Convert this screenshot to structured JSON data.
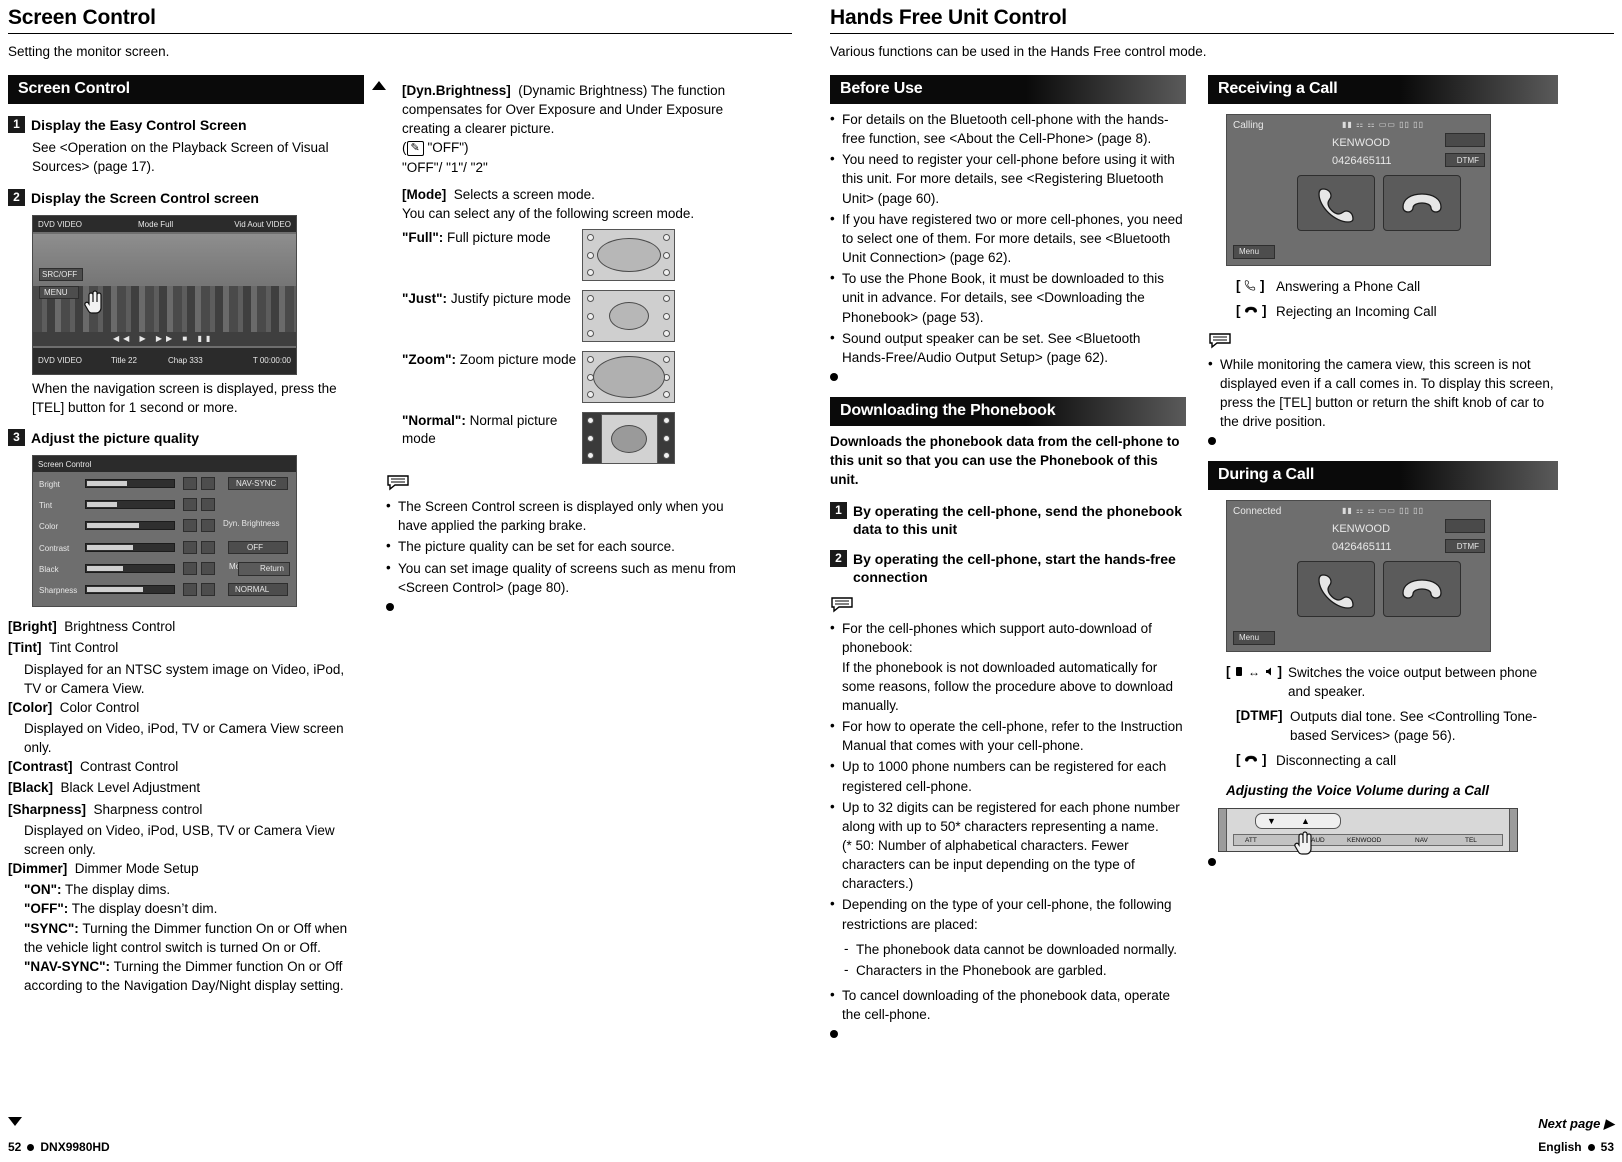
{
  "left_page": {
    "title": "Screen Control",
    "subtitle": "Setting the monitor screen.",
    "section1_header": "Screen Control",
    "steps": [
      {
        "num": "1",
        "label": "Display the Easy Control Screen",
        "body": "See <Operation on the Playback Screen of Visual Sources> (page 17)."
      },
      {
        "num": "2",
        "label": "Display the Screen Control screen",
        "body": "When the navigation screen is displayed, press the [TEL] button for 1 second or more."
      },
      {
        "num": "3",
        "label": "Adjust the picture quality",
        "body": ""
      }
    ],
    "screenshot1": {
      "top_left": "DVD VIDEO",
      "top_mid": "Mode  Full",
      "top_right": "Vid Aout  VIDEO",
      "btn1": "SRC/OFF",
      "btn2": "MENU",
      "bottom_left": "DVD VIDEO",
      "bottom_t": "Title 22",
      "bottom_c": "Chap 333",
      "bottom_time": "T 00:00:00"
    },
    "screenshot2": {
      "title": "Screen Control",
      "rows": [
        {
          "name": "Bright",
          "right": "NAV-SYNC"
        },
        {
          "name": "Tint",
          "right": ""
        },
        {
          "name": "Color",
          "right": "Dyn. Brightness"
        },
        {
          "name": "Contrast",
          "right": "OFF"
        },
        {
          "name": "Black",
          "right": "Mode"
        },
        {
          "name": "Sharpness",
          "right": "NORMAL"
        }
      ],
      "return_label": "Return"
    },
    "definitions": [
      {
        "key": "[Bright]",
        "val": "Brightness Control",
        "sub": []
      },
      {
        "key": "[Tint]",
        "val": "Tint Control",
        "sub": [
          "Displayed for an NTSC system image on Video, iPod, TV or Camera View."
        ]
      },
      {
        "key": "[Color]",
        "val": "Color Control",
        "sub": [
          "Displayed on Video, iPod, TV or Camera View screen only."
        ]
      },
      {
        "key": "[Contrast]",
        "val": "Contrast Control",
        "sub": []
      },
      {
        "key": "[Black]",
        "val": "Black Level Adjustment",
        "sub": []
      },
      {
        "key": "[Sharpness]",
        "val": "Sharpness control",
        "sub": [
          "Displayed on Video, iPod, USB, TV or Camera View screen only."
        ]
      },
      {
        "key": "[Dimmer]",
        "val": "Dimmer Mode Setup",
        "sub": []
      }
    ],
    "dimmer_options": [
      {
        "b": "\"ON\":",
        "t": " The display dims."
      },
      {
        "b": "\"OFF\":",
        "t": " The display doesn’t dim."
      },
      {
        "b": "\"SYNC\":",
        "t": " Turning the Dimmer function On or Off when the vehicle light control switch is turned On or Off."
      },
      {
        "b": "\"NAV-SYNC\":",
        "t": " Turning the Dimmer function On or Off according to the Navigation Day/Night display setting."
      }
    ],
    "dyn_brightness": {
      "key": "[Dyn.Brightness]",
      "paren": "(Dynamic Brightness)",
      "text": " The function compensates for Over Exposure and Under Exposure creating a clearer picture.",
      "values_line1": "\"OFF\")",
      "values_line2": "\"OFF\"/ \"1\"/ \"2\""
    },
    "mode": {
      "key": "[Mode]",
      "val": "Selects a screen mode.",
      "sub": "You can select any of the following screen mode.",
      "options": [
        {
          "b": "\"Full\":",
          "t": " Full picture mode",
          "kind": "full"
        },
        {
          "b": "\"Just\":",
          "t": " Justify picture mode",
          "kind": "just"
        },
        {
          "b": "\"Zoom\":",
          "t": " Zoom picture mode",
          "kind": "zoom"
        },
        {
          "b": "\"Normal\":",
          "t": " Normal picture mode",
          "kind": "normal"
        }
      ]
    },
    "notes": [
      "The Screen Control screen is displayed only when you have applied the parking brake.",
      "The picture quality can be set for each source.",
      "You can set image quality of screens such as menu from <Screen Control> (page 80)."
    ],
    "footer_page": "52",
    "footer_model": "DNX9980HD"
  },
  "right_page": {
    "title": "Hands Free Unit Control",
    "subtitle": "Various functions can be used in the Hands Free control mode.",
    "before_use": {
      "header": "Before Use",
      "bullets": [
        "For details on the Bluetooth cell-phone with the hands-free function, see <About the Cell-Phone> (page 8).",
        "You need to register your cell-phone before using it with this unit. For more details, see <Registering Bluetooth Unit> (page 60).",
        "If you have registered two or more cell-phones, you need to select one of them. For more details, see <Bluetooth Unit Connection> (page 62).",
        "To use the Phone Book, it must be downloaded to this unit in advance. For details, see <Downloading the Phonebook> (page 53).",
        "Sound output speaker can be set. See <Bluetooth Hands-Free/Audio Output Setup> (page 62)."
      ]
    },
    "downloading": {
      "header": "Downloading the Phonebook",
      "intro": "Downloads the phonebook data from the cell-phone to this unit so that you can use the Phonebook of this unit.",
      "steps": [
        {
          "num": "1",
          "label": "By operating the cell-phone, send the phonebook data to this unit"
        },
        {
          "num": "2",
          "label": "By operating the cell-phone, start the hands-free connection"
        }
      ],
      "notes": [
        "For the cell-phones which support auto-download of phonebook:\nIf the phonebook is not downloaded automatically for some reasons, follow the procedure above to download manually.",
        "For how to operate the cell-phone, refer to the Instruction Manual that comes with your cell-phone.",
        "Up to 1000 phone numbers can be registered for each registered cell-phone.",
        "Up to 32 digits can be registered for each phone number along with up to 50* characters representing a name.\n(* 50: Number of alphabetical characters. Fewer characters can be input depending on the type of characters.)",
        "Depending on the type of your cell-phone, the following restrictions are placed:",
        "To cancel downloading of the phonebook data, operate the cell-phone."
      ],
      "restrictions": [
        "The phonebook data cannot be downloaded normally.",
        "Characters in the Phonebook are garbled."
      ]
    },
    "receiving": {
      "header": "Receiving a Call",
      "screenshot": {
        "status": "Calling",
        "brand": "KENWOOD",
        "number": "0426465111",
        "dtmf": "DTMF",
        "menu": "Menu"
      },
      "items": [
        {
          "icon": "phone-handset-icon",
          "label": "Answering a Phone Call"
        },
        {
          "icon": "phone-hangup-icon",
          "label": "Rejecting an Incoming Call"
        }
      ],
      "note": "While monitoring the camera view, this screen is not displayed even if a call comes in. To display this screen, press the [TEL] button or return the shift knob of car to the drive position."
    },
    "during_call": {
      "header": "During a Call",
      "screenshot": {
        "status": "Connected",
        "brand": "KENWOOD",
        "number": "0426465111",
        "dtmf": "DTMF",
        "menu": "Menu"
      },
      "items": [
        {
          "icon": "speaker-phone-swap-icon",
          "label": "Switches the voice output between phone and speaker."
        },
        {
          "icon": "dtmf-label",
          "key": "[DTMF]",
          "label": "Outputs dial tone.  See <Controlling Tone-based Services> (page 56)."
        },
        {
          "icon": "phone-hangup-icon",
          "label": "Disconnecting a call"
        }
      ],
      "subheading": "Adjusting the Voice Volume during a Call",
      "faceplate_labels": [
        "ATT",
        "AUD",
        "KENWOOD",
        "NAV",
        "TEL"
      ]
    },
    "next_page": "Next page",
    "footer_lang": "English",
    "footer_page": "53"
  }
}
